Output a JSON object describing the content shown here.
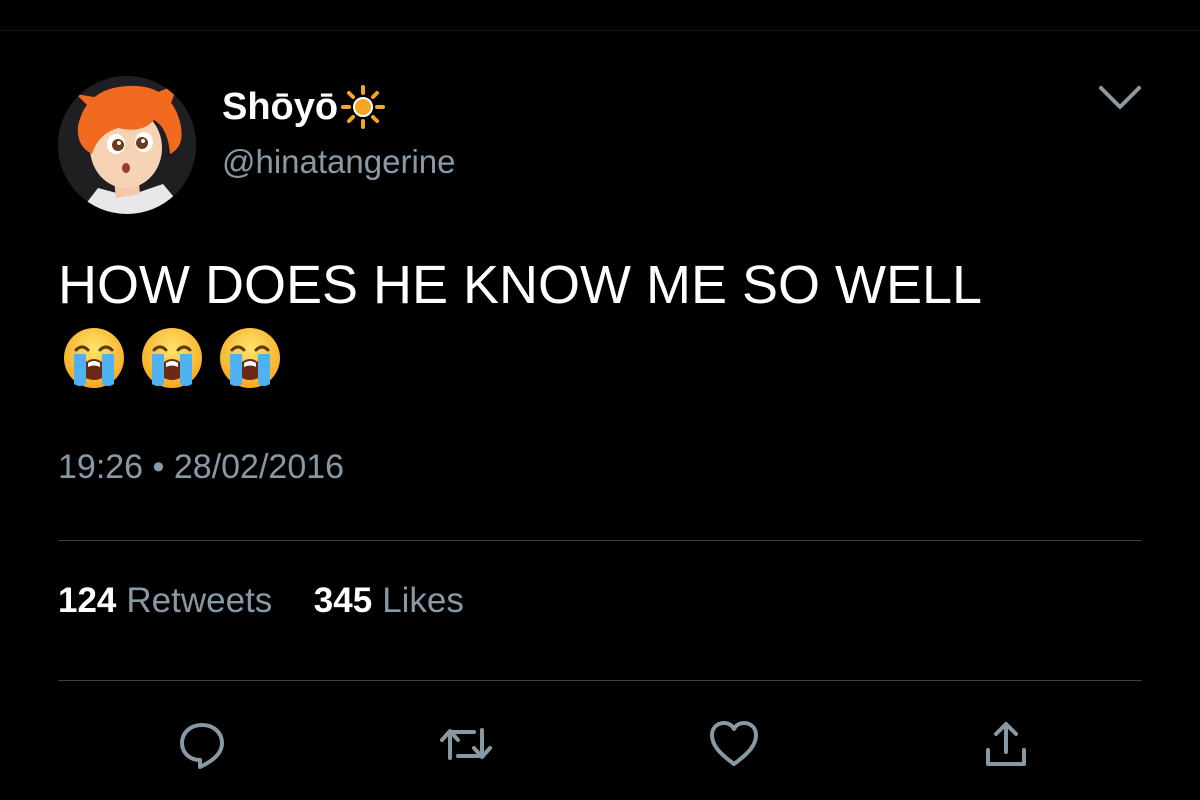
{
  "tweet": {
    "display_name": "Shōyō",
    "name_emoji_icon": "sun-icon",
    "handle": "@hinatangerine",
    "text": "HOW DOES HE KNOW ME SO WELL",
    "emojis": [
      "loudly-crying-face-icon",
      "loudly-crying-face-icon",
      "loudly-crying-face-icon"
    ],
    "timestamp": "19:26 • 28/02/2016",
    "stats": {
      "retweets_count": "124",
      "retweets_label": "Retweets",
      "likes_count": "345",
      "likes_label": "Likes"
    },
    "actions": [
      "reply-icon",
      "retweet-icon",
      "like-icon",
      "share-icon"
    ]
  },
  "colors": {
    "background": "#000000",
    "text_primary": "#ffffff",
    "text_secondary": "#8899a6",
    "divider": "#38444d",
    "sun": "#f5a623"
  }
}
